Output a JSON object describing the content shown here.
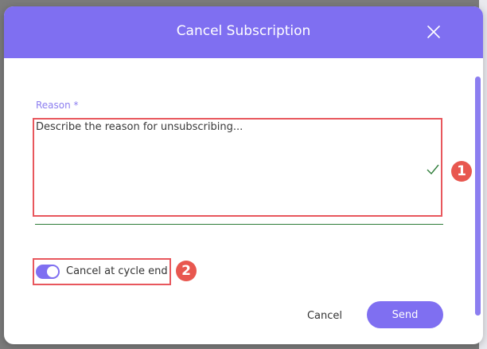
{
  "modal": {
    "title": "Cancel Subscription",
    "close_icon": "close-icon"
  },
  "reason": {
    "label": "Reason *",
    "placeholder": "Describe the reason for unsubscribing...",
    "valid_icon": "check-icon"
  },
  "cycle_toggle": {
    "label": "Cancel at cycle end",
    "checked": true
  },
  "actions": {
    "cancel_label": "Cancel",
    "send_label": "Send"
  },
  "annotations": {
    "marker_1": "1",
    "marker_2": "2",
    "highlight_color": "#e8575d"
  },
  "colors": {
    "accent": "#7f6ff1",
    "valid": "#2f7d3a"
  }
}
